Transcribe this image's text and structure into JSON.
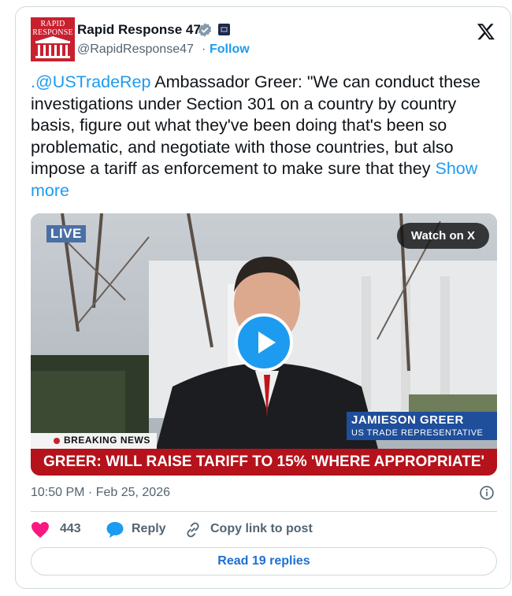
{
  "author": {
    "name": "Rapid Response 47",
    "handle": "@RapidResponse47",
    "follow_label": "Follow",
    "avatar_line1": "RAPID",
    "avatar_line2": "RESPONSE"
  },
  "tweet": {
    "mention": ".@USTradeRep",
    "body": " Ambassador Greer: \"We can conduct these investigations under Section 301 on a country by country basis, figure out what they've been doing that's been so problematic, and negotiate with those countries, but also impose a tariff as enforcement to make sure that they ",
    "show_more": "Show more"
  },
  "video": {
    "live_label": "LIVE",
    "watch_label": "Watch on X",
    "nameplate_name": "JAMIESON GREER",
    "nameplate_title": "US TRADE REPRESENTATIVE",
    "breaking_label": "BREAKING NEWS",
    "headline": "GREER: WILL RAISE TARIFF TO 15% 'WHERE APPROPRIATE'"
  },
  "meta": {
    "timestamp": "10:50 PM · Feb 25, 2026"
  },
  "actions": {
    "likes": "443",
    "reply_label": "Reply",
    "copy_label": "Copy link to post",
    "read_replies_label": "Read 19 replies"
  },
  "colors": {
    "accent": "#1d9bf0",
    "like": "#f91880",
    "banner": "#b5121b",
    "nameplate": "#1f4e9a"
  },
  "icons": [
    "verified-badge-icon",
    "affiliate-badge-icon",
    "x-logo-icon",
    "play-icon",
    "info-icon",
    "heart-icon",
    "reply-bubble-icon",
    "link-icon"
  ]
}
